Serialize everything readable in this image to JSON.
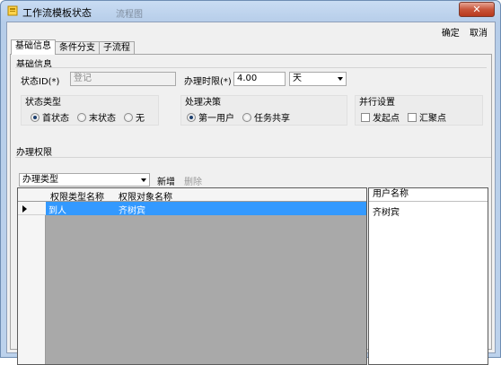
{
  "window": {
    "title": "工作流模板状态",
    "ghost_text": "流程图",
    "close_glyph": "✕"
  },
  "toolbar": {
    "confirm_label": "确定",
    "cancel_label": "取消"
  },
  "tabs": [
    {
      "label": "基础信息",
      "active": true
    },
    {
      "label": "条件分支",
      "active": false
    },
    {
      "label": "子流程",
      "active": false
    }
  ],
  "basic": {
    "group_title": "基础信息",
    "state_id_label": "状态ID(*)",
    "state_id_value": "登记",
    "time_limit_label": "办理时限(*)",
    "time_limit_value": "4.00",
    "time_unit_value": "天"
  },
  "state_type": {
    "title": "状态类型",
    "options": [
      {
        "label": "首状态",
        "checked": true
      },
      {
        "label": "末状态",
        "checked": false
      },
      {
        "label": "无",
        "checked": false
      }
    ]
  },
  "decision": {
    "title": "处理决策",
    "options": [
      {
        "label": "第一用户",
        "checked": true
      },
      {
        "label": "任务共享",
        "checked": false
      }
    ]
  },
  "parallel": {
    "title": "并行设置",
    "options": [
      {
        "label": "发起点",
        "checked": false
      },
      {
        "label": "汇聚点",
        "checked": false
      }
    ]
  },
  "permission": {
    "group_title": "办理权限",
    "type_combo_value": "办理类型",
    "add_label": "新增",
    "delete_label": "删除",
    "columns": [
      "权限类型名称",
      "权限对象名称"
    ],
    "rows": [
      {
        "type_name": "到人",
        "object_name": "齐树宾"
      }
    ]
  },
  "users": {
    "column": "用户名称",
    "items": [
      "齐树宾"
    ]
  },
  "colors": {
    "selection": "#3399ff",
    "grid_bg": "#a9a9a9",
    "close_red": "#c8553a"
  }
}
